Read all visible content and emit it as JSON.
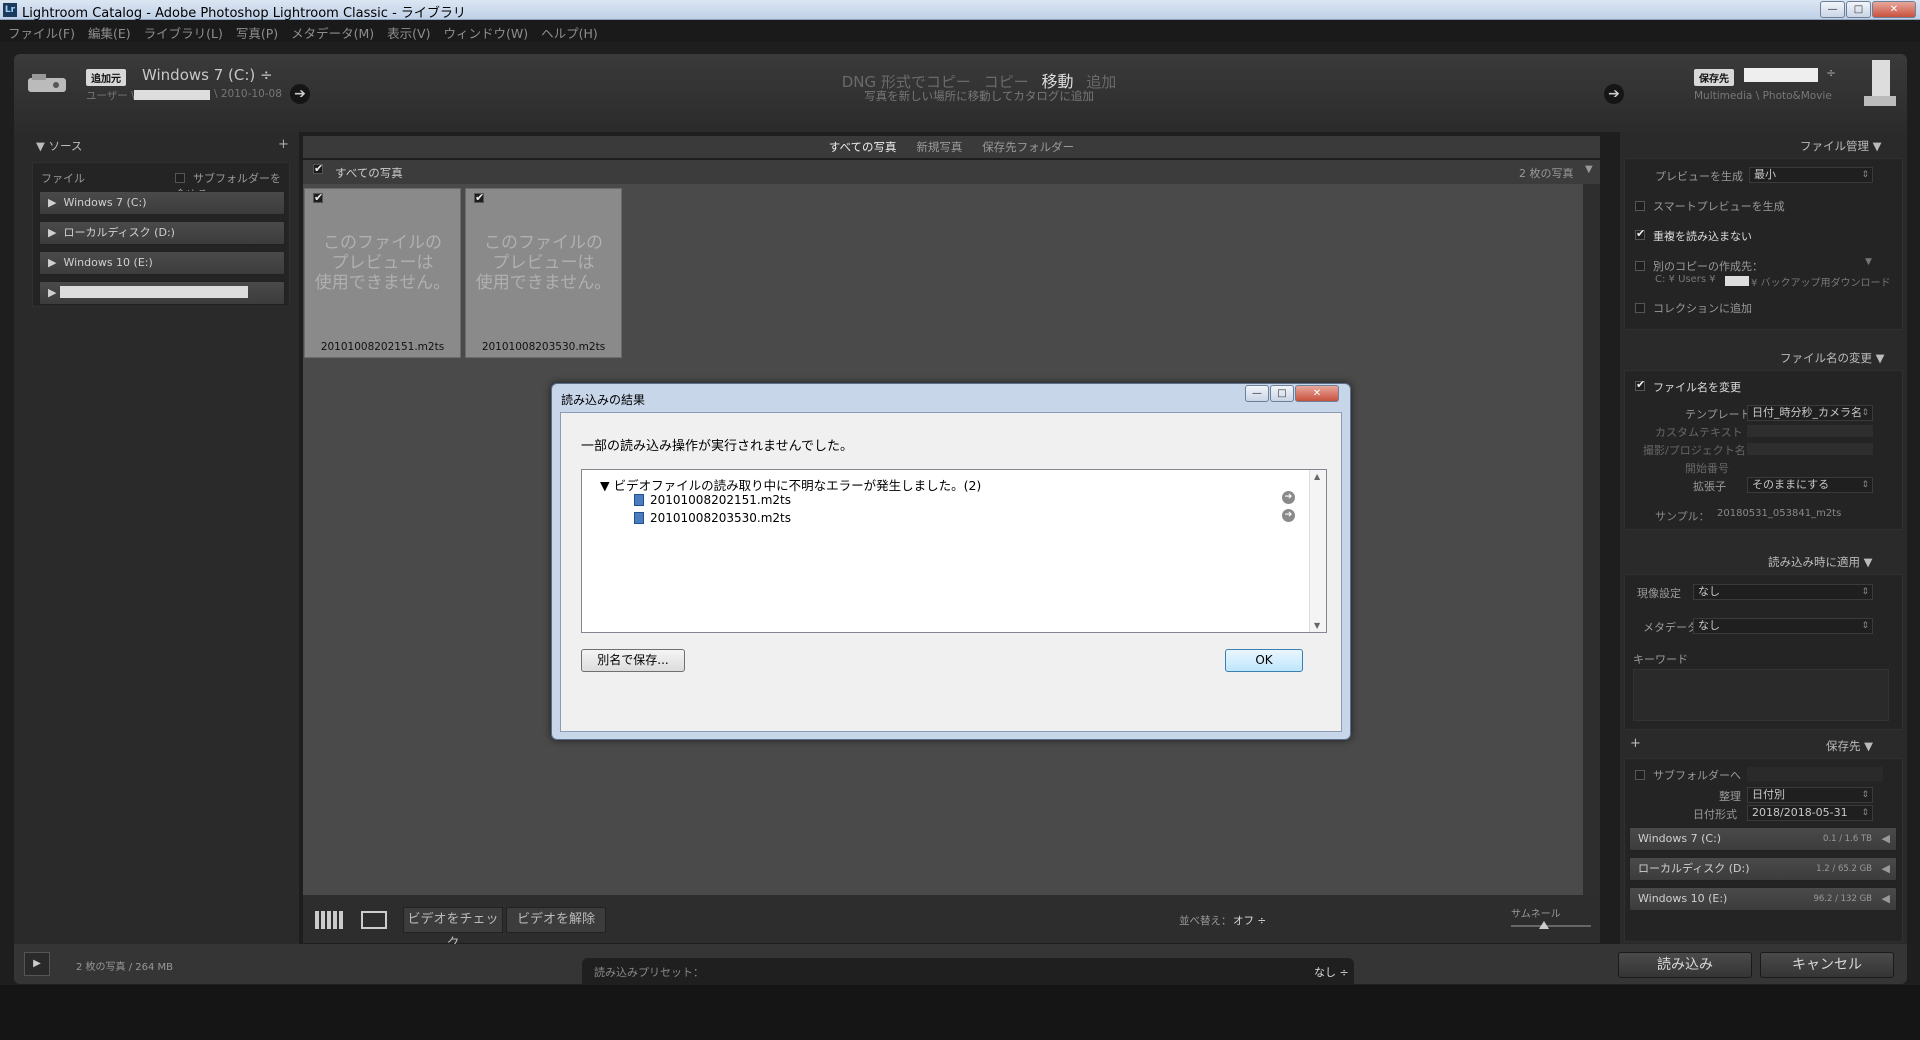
{
  "window": {
    "app_icon": "Lr",
    "title": "Lightroom Catalog - Adobe Photoshop Lightroom Classic - ライブラリ",
    "btn_min": "—",
    "btn_max": "□",
    "btn_close": "✕"
  },
  "menu": [
    "ファイル(F)",
    "編集(E)",
    "ライブラリ(L)",
    "写真(P)",
    "メタデータ(M)",
    "表示(V)",
    "ウィンドウ(W)",
    "ヘルプ(H)"
  ],
  "header": {
    "source_tag": "追加元",
    "source_name": "Windows 7 (C:) ÷",
    "source_path": "ユーザー \\",
    "source_date": "\\ 2010-10-08",
    "modes": [
      "DNG 形式でコピー",
      "コピー",
      "移動",
      "追加"
    ],
    "active_mode": "移動",
    "mode_desc": "写真を新しい場所に移動してカタログに追加",
    "dest_tag": "保存先",
    "dest_path": "Multimedia \\ Photo&Movie"
  },
  "source_panel": {
    "title": "ソース",
    "files_label": "ファイル",
    "subfolder_label": "サブフォルダーを含める",
    "drives": [
      "Windows 7 (C:)",
      "ローカルディスク (D:)",
      "Windows 10 (E:)"
    ]
  },
  "grid": {
    "tabs": [
      "すべての写真",
      "新規写真",
      "保存先フォルダー"
    ],
    "all_photos_label": "すべての写真",
    "count_label": "2 枚の写真",
    "no_preview": "このファイルの\nプレビューは\n使用できません。",
    "files": [
      "20101008202151.m2ts",
      "20101008203530.m2ts"
    ],
    "check_video": "ビデオをチェック",
    "uncheck_video": "ビデオを解除",
    "sort_label": "並べ替え：",
    "sort_value": "オフ ÷",
    "thumb_label": "サムネール"
  },
  "dialog": {
    "title": "読み込みの結果",
    "message": "一部の読み込み操作が実行されませんでした。",
    "error_header": "ビデオファイルの読み取り中に不明なエラーが発生しました。(2)",
    "error_files": [
      "20101008202151.m2ts",
      "20101008203530.m2ts"
    ],
    "save_as": "別名で保存...",
    "ok": "OK"
  },
  "right_panel": {
    "file_handling": "ファイル管理",
    "build_previews_label": "プレビューを生成",
    "build_previews_value": "最小",
    "smart_previews": "スマートプレビューを生成",
    "no_duplicates": "重複を読み込まない",
    "second_copy": "別のコピーの作成先：",
    "second_copy_path": "C: ¥ Users ¥",
    "second_copy_path2": "¥ バックアップ用ダウンロード",
    "add_collection": "コレクションに追加",
    "rename_section": "ファイル名の変更",
    "rename_files": "ファイル名を変更",
    "template_label": "テンプレート",
    "template_value": "日付_時分秒_カメラ名",
    "custom_text": "カスタムテキスト",
    "shoot_name": "撮影/プロジェクト名",
    "start_number": "開始番号",
    "extension_label": "拡張子",
    "extension_value": "そのままにする",
    "sample_label": "サンプル：",
    "sample_value": "20180531_053841_m2ts",
    "apply_section": "読み込み時に適用",
    "develop_label": "現像設定",
    "develop_value": "なし",
    "metadata_label": "メタデータ",
    "metadata_value": "なし",
    "keywords_label": "キーワード",
    "destination": "保存先",
    "into_subfolder": "サブフォルダーへ",
    "organize_label": "整理",
    "organize_value": "日付別",
    "date_format_label": "日付形式",
    "date_format_value": "2018/2018-05-31",
    "dest_drives": [
      {
        "name": "Windows 7 (C:)",
        "size": "0.1 / 1.6 TB"
      },
      {
        "name": "ローカルディスク (D:)",
        "size": "1.2 / 65.2 GB"
      },
      {
        "name": "Windows 10 (E:)",
        "size": "96.2 / 132 GB"
      }
    ]
  },
  "bottom": {
    "status": "2 枚の写真 / 264 MB",
    "preset_label": "読み込みプリセット：",
    "preset_value": "なし ÷",
    "import_btn": "読み込み",
    "cancel_btn": "キャンセル"
  }
}
